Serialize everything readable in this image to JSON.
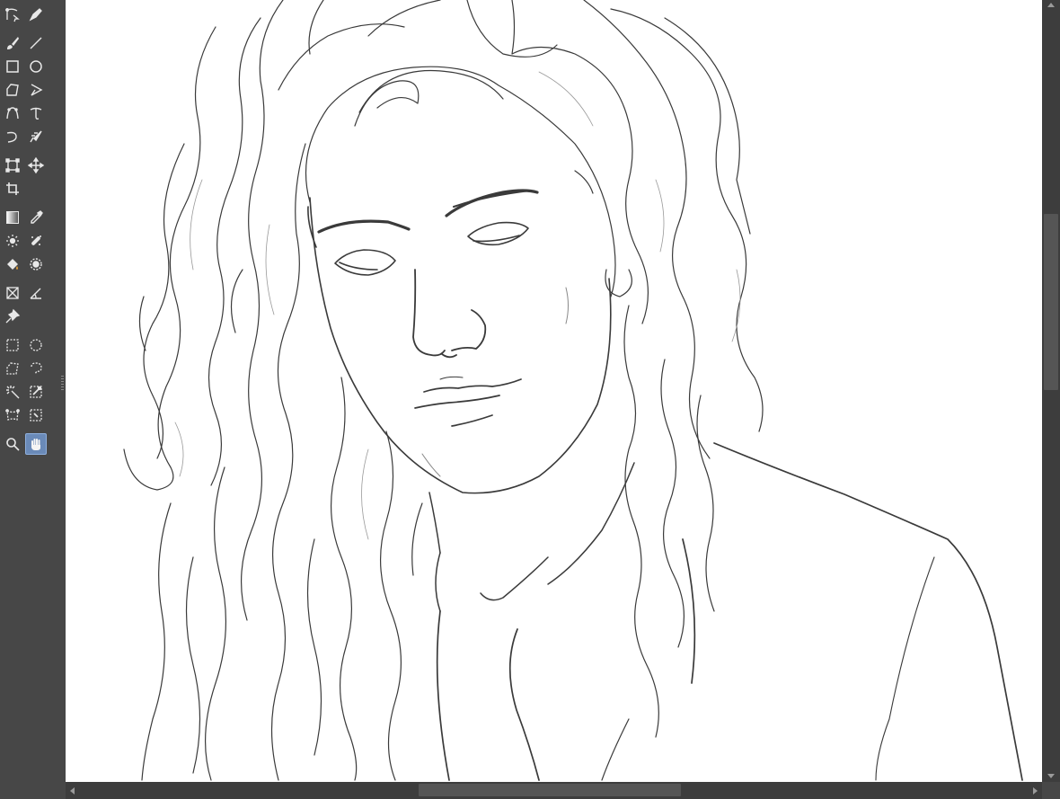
{
  "toolbox": {
    "tools": [
      {
        "name": "vector-select-tool",
        "icon": "vector-select-icon"
      },
      {
        "name": "pen-tool",
        "icon": "pen-icon"
      },
      {
        "name": "brush-tool",
        "icon": "brush-icon"
      },
      {
        "name": "line-tool",
        "icon": "line-icon"
      },
      {
        "name": "rectangle-tool",
        "icon": "rectangle-icon"
      },
      {
        "name": "ellipse-tool",
        "icon": "ellipse-icon"
      },
      {
        "name": "polygon-tool",
        "icon": "polygon-icon"
      },
      {
        "name": "polyline-tool",
        "icon": "polyline-icon"
      },
      {
        "name": "bezier-curve-tool",
        "icon": "bezier-icon"
      },
      {
        "name": "freehand-path-tool",
        "icon": "freehand-path-icon"
      },
      {
        "name": "dynamic-brush-tool",
        "icon": "dynamic-brush-icon"
      },
      {
        "name": "multibrush-tool",
        "icon": "multibrush-icon"
      },
      {
        "name": "transform-tool",
        "icon": "transform-icon"
      },
      {
        "name": "move-tool",
        "icon": "move-icon"
      },
      {
        "name": "crop-tool",
        "icon": "crop-icon"
      },
      {
        "name": "gradient-tool",
        "icon": "gradient-icon"
      },
      {
        "name": "color-sampler-tool",
        "icon": "eyedropper-icon"
      },
      {
        "name": "colorize-mask-tool",
        "icon": "colorize-mask-icon"
      },
      {
        "name": "smart-patch-tool",
        "icon": "smart-patch-icon"
      },
      {
        "name": "fill-tool",
        "icon": "bucket-icon"
      },
      {
        "name": "enclose-fill-tool",
        "icon": "enclose-fill-icon"
      },
      {
        "name": "assistant-tool",
        "icon": "assistant-icon"
      },
      {
        "name": "measure-tool",
        "icon": "measure-icon"
      },
      {
        "name": "reference-images-tool",
        "icon": "pin-icon"
      },
      {
        "name": "rectangular-selection-tool",
        "icon": "rect-selection-icon"
      },
      {
        "name": "elliptical-selection-tool",
        "icon": "ellipse-selection-icon"
      },
      {
        "name": "polygonal-selection-tool",
        "icon": "polygon-selection-icon"
      },
      {
        "name": "freehand-selection-tool",
        "icon": "freehand-selection-icon"
      },
      {
        "name": "contiguous-selection-tool",
        "icon": "magic-wand-icon"
      },
      {
        "name": "similar-color-selection-tool",
        "icon": "similar-selection-icon"
      },
      {
        "name": "bezier-selection-tool",
        "icon": "bezier-selection-icon"
      },
      {
        "name": "magnetic-selection-tool",
        "icon": "magnetic-selection-icon"
      },
      {
        "name": "zoom-tool",
        "icon": "zoom-icon"
      },
      {
        "name": "pan-tool",
        "icon": "hand-icon",
        "active": true
      }
    ]
  },
  "canvas": {
    "content": "line-art-sketch-portrait"
  },
  "colors": {
    "ui_background": "#474747",
    "scrollbar_track": "#3d3d3d",
    "scrollbar_thumb": "#555555",
    "canvas": "#ffffff",
    "active_tool": "#6a8ab8",
    "icon": "#e8e8e8"
  }
}
